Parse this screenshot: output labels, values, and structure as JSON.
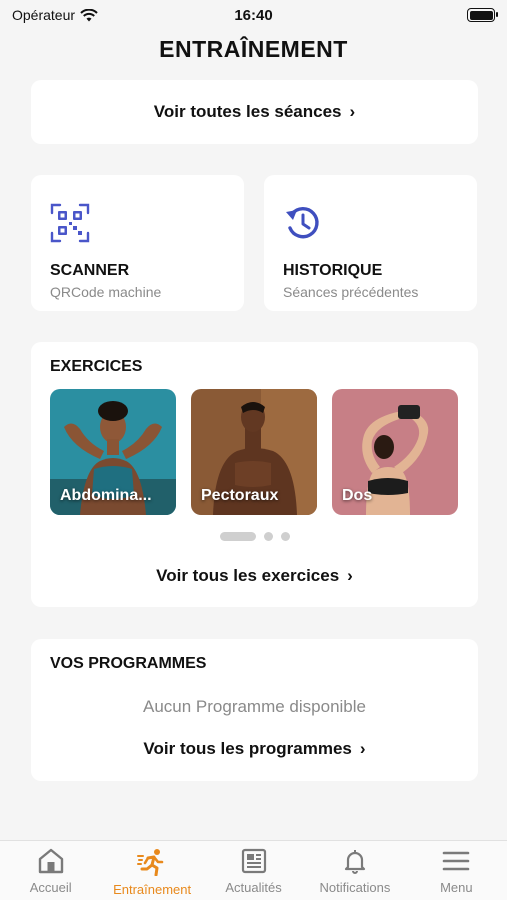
{
  "status_bar": {
    "carrier": "Opérateur",
    "time": "16:40"
  },
  "header": {
    "title": "ENTRAÎNEMENT"
  },
  "sessions": {
    "link_label": "Voir toutes les séances"
  },
  "tiles": {
    "scanner": {
      "title": "SCANNER",
      "subtitle": "QRCode machine",
      "icon": "qr-code-icon",
      "color": "#4a56c9"
    },
    "history": {
      "title": "HISTORIQUE",
      "subtitle": "Séances précédentes",
      "icon": "history-icon",
      "color": "#3f4fbf"
    }
  },
  "exercises": {
    "title": "EXERCICES",
    "items": [
      {
        "label": "Abdomina..."
      },
      {
        "label": "Pectoraux"
      },
      {
        "label": "Dos"
      }
    ],
    "carousel_page": 1,
    "carousel_pages": 3,
    "link_label": "Voir tous les exercices"
  },
  "programs": {
    "title": "VOS PROGRAMMES",
    "empty_message": "Aucun Programme disponible",
    "link_label": "Voir tous les programmes"
  },
  "tabbar": {
    "active_color": "#e8891c",
    "items": [
      {
        "label": "Accueil",
        "icon": "home-icon"
      },
      {
        "label": "Entraînement",
        "icon": "running-icon",
        "active": true
      },
      {
        "label": "Actualités",
        "icon": "newspaper-icon"
      },
      {
        "label": "Notifications",
        "icon": "bell-icon"
      },
      {
        "label": "Menu",
        "icon": "menu-icon"
      }
    ]
  }
}
